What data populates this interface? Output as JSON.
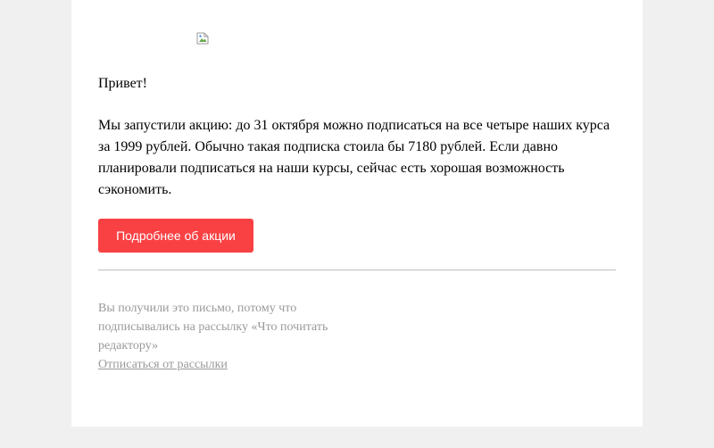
{
  "email": {
    "greeting": "Привет!",
    "body": "Мы запустили акцию: до 31 октября можно подписаться на все четыре наших курса за 1999 рублей. Обычно такая подписка стоила бы 7180 рублей. Если давно планировали подписаться на наши курсы, сейчас есть хорошая возможность сэкономить.",
    "cta_label": "Подробнее об акции",
    "footer_text": "Вы получили это письмо, потому что подписывались на рассылку «Что почитать редактору»",
    "unsubscribe_label": "Отписаться от рассылки",
    "header_image_icon": "broken-image-icon"
  },
  "colors": {
    "page_background": "#f0f0f0",
    "card_background": "#ffffff",
    "cta_background": "#f94144",
    "muted_text": "#999999"
  }
}
